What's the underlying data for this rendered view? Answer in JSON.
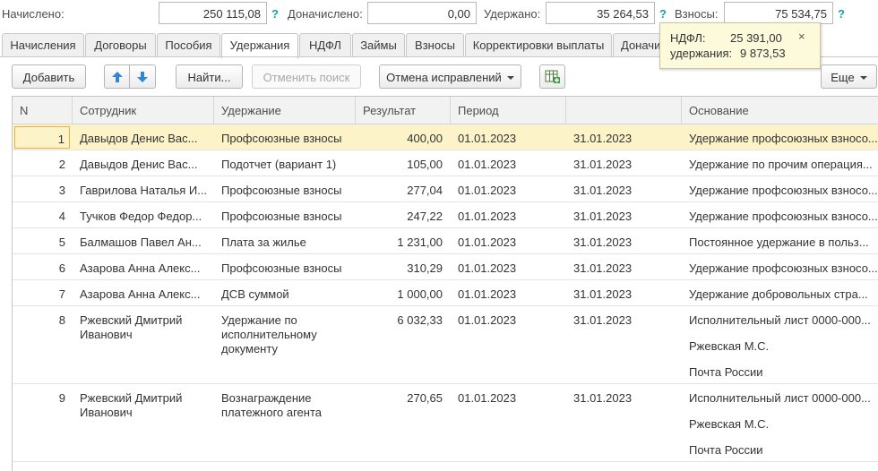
{
  "summary": {
    "accrued_label": "Начислено:",
    "accrued_value": "250 115,08",
    "additional_label": "Доначислено:",
    "additional_value": "0,00",
    "withheld_label": "Удержано:",
    "withheld_value": "35 264,53",
    "contributions_label": "Взносы:",
    "contributions_value": "75 534,75",
    "help_glyph": "?"
  },
  "tabs": [
    {
      "label": "Начисления"
    },
    {
      "label": "Договоры"
    },
    {
      "label": "Пособия"
    },
    {
      "label": "Удержания",
      "active": true
    },
    {
      "label": "НДФЛ"
    },
    {
      "label": "Займы"
    },
    {
      "label": "Взносы"
    },
    {
      "label": "Корректировки выплаты"
    },
    {
      "label": "Доначи"
    }
  ],
  "popup": {
    "ndfl_label": "НДФЛ:",
    "ndfl_value": "25 391,00",
    "withheld_label": "удержания:",
    "withheld_value": "9 873,53",
    "close": "×"
  },
  "toolbar": {
    "add_label": "Добавить",
    "find_label": "Найти...",
    "cancel_search_label": "Отменить поиск",
    "cancel_corrections_label": "Отмена исправлений",
    "more_label": "Еще"
  },
  "table": {
    "columns": [
      "N",
      "Сотрудник",
      "Удержание",
      "Результат",
      "Период",
      "",
      "Основание"
    ],
    "rows": [
      {
        "n": "1",
        "employee": "Давыдов Денис Вас...",
        "deduction": "Профсоюзные взносы",
        "result": "400,00",
        "from": "01.01.2023",
        "to": "31.01.2023",
        "basis": [
          "Удержание профсоюзных взносо..."
        ]
      },
      {
        "n": "2",
        "employee": "Давыдов Денис Вас...",
        "deduction": "Подотчет (вариант 1)",
        "result": "105,00",
        "from": "01.01.2023",
        "to": "31.01.2023",
        "basis": [
          "Удержание по прочим операция..."
        ]
      },
      {
        "n": "3",
        "employee": "Гаврилова Наталья И...",
        "deduction": "Профсоюзные взносы",
        "result": "277,04",
        "from": "01.01.2023",
        "to": "31.01.2023",
        "basis": [
          "Удержание профсоюзных взносо..."
        ]
      },
      {
        "n": "4",
        "employee": "Тучков Федор Федор...",
        "deduction": "Профсоюзные взносы",
        "result": "247,22",
        "from": "01.01.2023",
        "to": "31.01.2023",
        "basis": [
          "Удержание профсоюзных взносо..."
        ]
      },
      {
        "n": "5",
        "employee": "Балмашов Павел Ан...",
        "deduction": "Плата за жилье",
        "result": "1 231,00",
        "from": "01.01.2023",
        "to": "31.01.2023",
        "basis": [
          "Постоянное удержание в польз..."
        ]
      },
      {
        "n": "6",
        "employee": "Азарова Анна Алекс...",
        "deduction": "Профсоюзные взносы",
        "result": "310,29",
        "from": "01.01.2023",
        "to": "31.01.2023",
        "basis": [
          "Удержание профсоюзных взносо..."
        ]
      },
      {
        "n": "7",
        "employee": "Азарова Анна Алекс...",
        "deduction": "ДСВ суммой",
        "result": "1 000,00",
        "from": "01.01.2023",
        "to": "31.01.2023",
        "basis": [
          "Удержание добровольных стра..."
        ]
      },
      {
        "n": "8",
        "employee": "Ржевский Дмитрий Иванович",
        "deduction": "Удержание по исполнительному документу",
        "result": "6 032,33",
        "from": "01.01.2023",
        "to": "31.01.2023",
        "basis": [
          "Исполнительный лист 0000-000...",
          "Ржевская М.С.",
          "Почта России"
        ]
      },
      {
        "n": "9",
        "employee": "Ржевский Дмитрий Иванович",
        "deduction": "Вознаграждение платежного агента",
        "result": "270,65",
        "from": "01.01.2023",
        "to": "31.01.2023",
        "basis": [
          "Исполнительный лист 0000-000...",
          "Ржевская М.С.",
          "Почта России"
        ]
      }
    ]
  }
}
